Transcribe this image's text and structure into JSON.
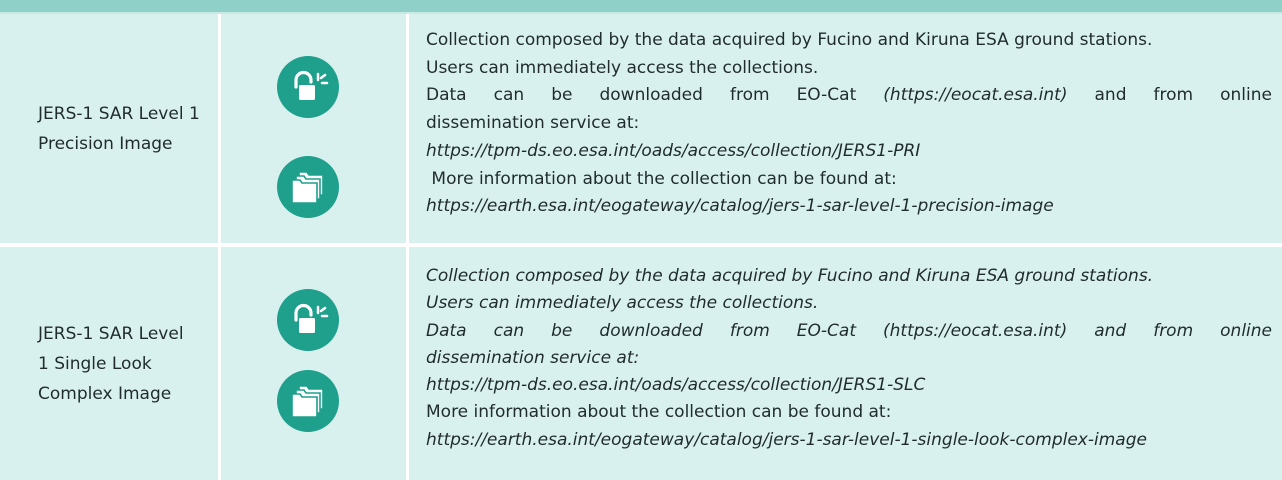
{
  "rows": [
    {
      "name_line1": "JERS-1 SAR Level 1",
      "name_line2": "Precision Image",
      "desc": {
        "l1": "Collection composed by the data acquired by Fucino and Kiruna ESA ground stations.",
        "l2": "Users can immediately access the collections.",
        "l3a": "Data can be downloaded from EO-Cat ",
        "l3b": "(https://eocat.esa.int)",
        "l3c": " and from online",
        "l4": "dissemination service at:",
        "l5": "https://tpm-ds.eo.esa.int/oads/access/collection/JERS1-PRI",
        "l6": " More information about the collection can be found at:",
        "l7": "https://earth.esa.int/eogateway/catalog/jers-1-sar-level-1-precision-image"
      },
      "icons": [
        "open-lock-icon",
        "folders-icon"
      ]
    },
    {
      "name_line1": "JERS-1 SAR Level",
      "name_line2": "1 Single Look",
      "name_line3": "Complex Image",
      "desc": {
        "l1": "Collection composed by the data acquired by Fucino and Kiruna ESA ground stations.",
        "l2": "Users can immediately access the collections.",
        "l3": "Data can be downloaded from EO-Cat (https://eocat.esa.int) and from online",
        "l4": "dissemination service at:",
        "l5": "https://tpm-ds.eo.esa.int/oads/access/collection/JERS1-SLC",
        "l6": "More information about the collection can be found at:",
        "l7": "https://earth.esa.int/eogateway/catalog/jers-1-sar-level-1-single-look-complex-image"
      },
      "icons": [
        "open-lock-icon",
        "folders-icon"
      ]
    }
  ],
  "colors": {
    "row_bg": "#d9f1ee",
    "icon_bg": "#1ea08c",
    "header_bar": "#8fd0c9"
  }
}
